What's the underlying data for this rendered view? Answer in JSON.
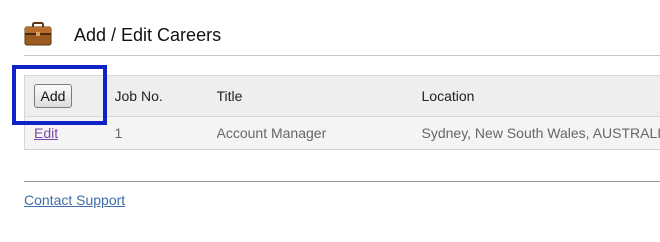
{
  "header": {
    "icon": "briefcase-icon",
    "title": "Add / Edit Careers"
  },
  "table": {
    "add_button_label": "Add",
    "columns": [
      "Job No.",
      "Title",
      "Location"
    ],
    "rows": [
      {
        "action_label": "Edit",
        "job_no": "1",
        "title": "Account Manager",
        "location": "Sydney, New South Wales, AUSTRALIA"
      }
    ]
  },
  "footer": {
    "contact_link": "Contact Support"
  },
  "colors": {
    "highlight": "#0e22c8",
    "link_visited": "#7a4aa6",
    "link": "#3f6da8"
  }
}
